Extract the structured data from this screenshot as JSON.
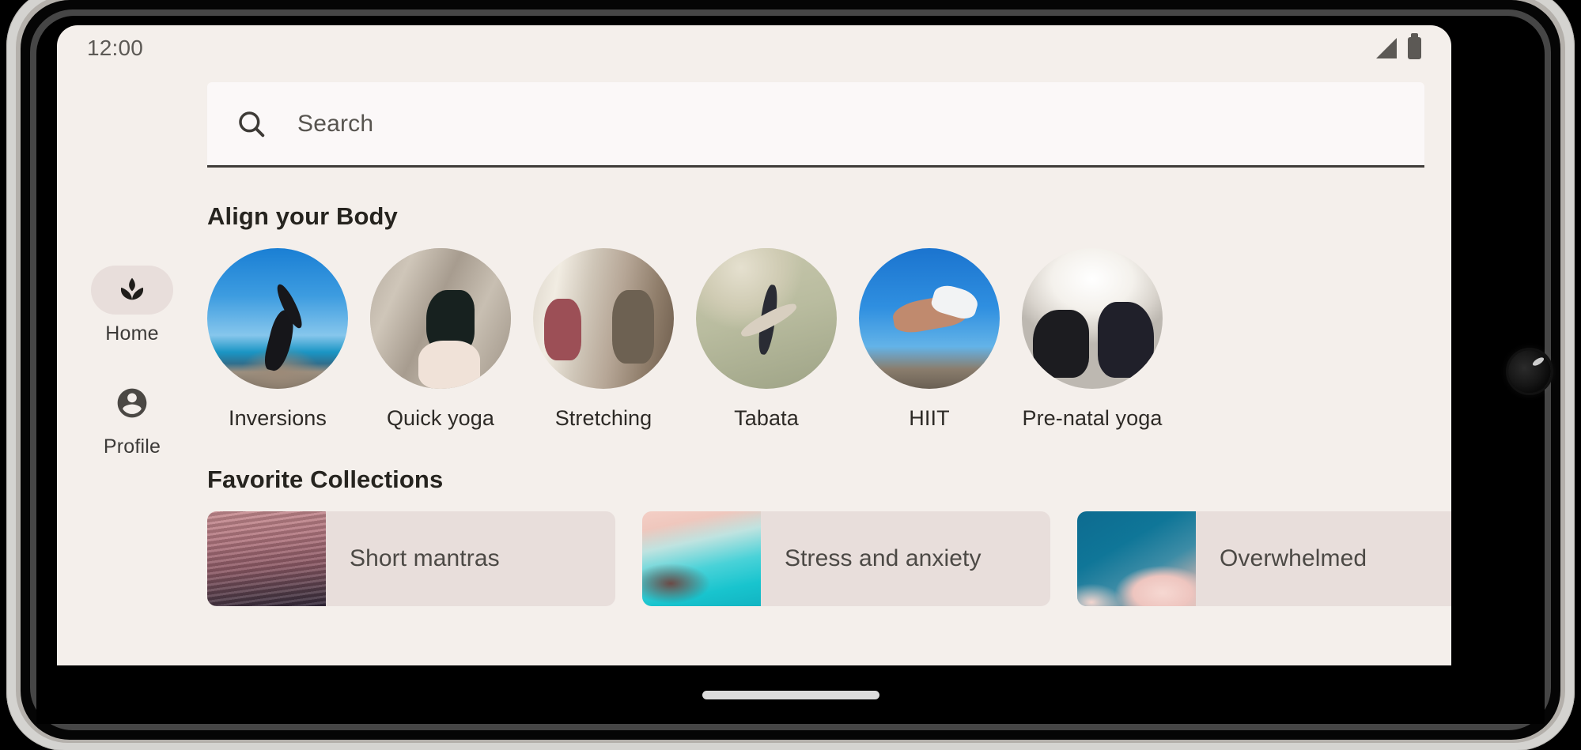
{
  "device": {
    "orientation": "landscape",
    "frame_color": "#d4d3d0",
    "bezel_color": "#050505",
    "camera_icon": "front-camera-punch-hole"
  },
  "screen": {
    "background_color": "#f4efeb"
  },
  "status_bar": {
    "time": "12:00",
    "signal_icon": "cellular-signal-icon",
    "battery_icon": "battery-full-icon",
    "text_color": "#5c5955"
  },
  "search": {
    "placeholder": "Search",
    "value": "",
    "icon": "search-icon",
    "background_color": "#fbf8f8",
    "underline_color": "#3f3c39"
  },
  "nav_rail": {
    "items": [
      {
        "label": "Home",
        "icon": "spa-lotus-icon",
        "active": true
      },
      {
        "label": "Profile",
        "icon": "account-circle-icon",
        "active": false
      }
    ],
    "active_pill_color": "#e8dedb"
  },
  "sections": [
    {
      "title": "Align your Body",
      "type": "circle-row",
      "items": [
        {
          "label": "Inversions",
          "image": "woman-handstand-beach",
          "theme": "ph-inversions"
        },
        {
          "label": "Quick yoga",
          "image": "woman-seated-stretch-woods",
          "theme": "ph-quickyoga"
        },
        {
          "label": "Stretching",
          "image": "two-women-studio-stretch",
          "theme": "ph-stretching"
        },
        {
          "label": "Tabata",
          "image": "man-standing-split-green-wall",
          "theme": "ph-tabata"
        },
        {
          "label": "HIIT",
          "image": "man-plank-blue-sky",
          "theme": "ph-hiit"
        },
        {
          "label": "Pre-natal yoga",
          "image": "prenatal-pose-bright-window",
          "theme": "ph-prenatal"
        }
      ]
    },
    {
      "title": "Favorite Collections",
      "type": "card-row",
      "items": [
        {
          "label": "Short mantras",
          "image": "pink-rippled-water",
          "theme": "ph-mantras"
        },
        {
          "label": "Stress and anxiety",
          "image": "turquoise-pink-shoreline",
          "theme": "ph-stress"
        },
        {
          "label": "Overwhelmed",
          "image": "blue-sky-pink-clouds",
          "theme": "ph-overwhelmed"
        }
      ],
      "card_background_color": "#e8dedb"
    }
  ],
  "gesture_bar": {
    "handle_color": "#dcdcdc",
    "icon": "home-gesture-handle"
  }
}
